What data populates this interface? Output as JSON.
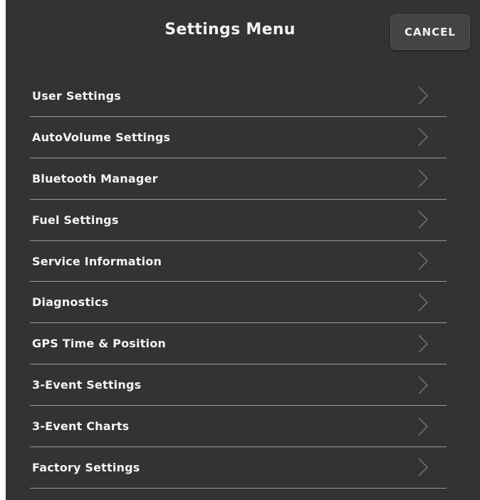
{
  "header": {
    "title": "Settings Menu",
    "cancel_label": "CANCEL"
  },
  "menu": {
    "items": [
      {
        "label": "User Settings",
        "icon": "chevron-right-icon"
      },
      {
        "label": "AutoVolume Settings",
        "icon": "chevron-right-icon"
      },
      {
        "label": "Bluetooth Manager",
        "icon": "chevron-right-icon"
      },
      {
        "label": "Fuel Settings",
        "icon": "chevron-right-icon"
      },
      {
        "label": "Service Information",
        "icon": "chevron-right-icon"
      },
      {
        "label": "Diagnostics",
        "icon": "chevron-right-icon"
      },
      {
        "label": "GPS Time & Position",
        "icon": "chevron-right-icon"
      },
      {
        "label": "3-Event Settings",
        "icon": "chevron-right-icon"
      },
      {
        "label": "3-Event Charts",
        "icon": "chevron-right-icon"
      },
      {
        "label": "Factory Settings",
        "icon": "chevron-right-icon"
      }
    ]
  },
  "colors": {
    "background": "#333333",
    "text": "#f4f4f4",
    "divider": "#9a9a9a",
    "button": "#444444"
  }
}
